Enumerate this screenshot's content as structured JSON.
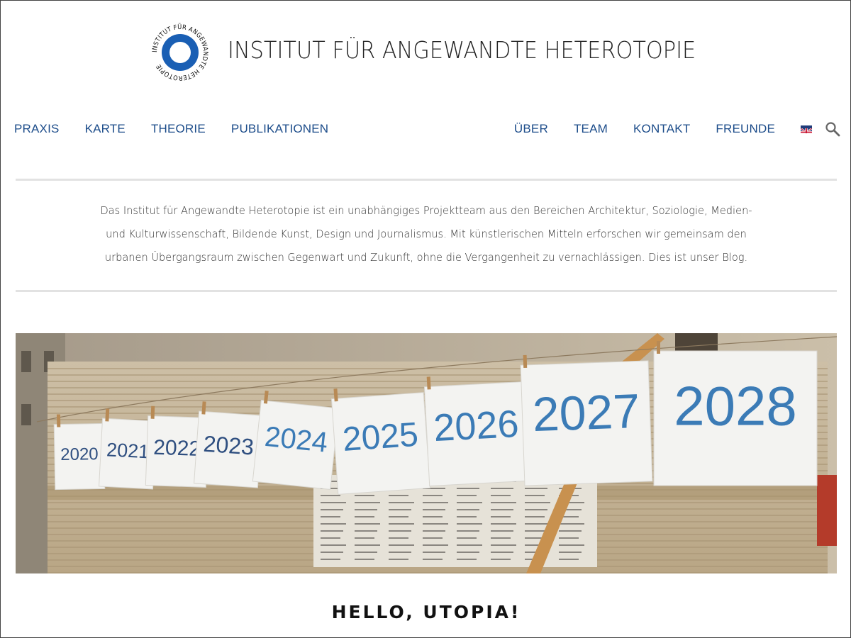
{
  "site": {
    "title": "INSTITUT FÜR ANGEWANDTE HETEROTOPIE",
    "logo_text": "INSTITUT FÜR ANGEWANDTE HETEROTOPIE",
    "logo_color": "#1a5fb4"
  },
  "nav": {
    "left": [
      "PRAXIS",
      "KARTE",
      "THEORIE",
      "PUBLIKATIONEN"
    ],
    "right": [
      "ÜBER",
      "TEAM",
      "KONTAKT",
      "FREUNDE"
    ],
    "language_flag": "uk-flag-icon",
    "search": "search-icon",
    "link_color": "#1c4c8a"
  },
  "intro": {
    "text": "Das Institut für Angewandte Heterotopie ist ein unabhängiges Projektteam aus den Bereichen Architektur, Soziologie, Medien- und Kulturwissenschaft, Bildende Kunst, Design und Journalismus. Mit künstlerischen Mitteln erforschen wir gemeinsam den urbanen Übergangsraum zwischen Gegenwart und Zukunft, ohne die Vergangenheit zu vernachlässigen. Dies ist unser Blog."
  },
  "hero": {
    "years": [
      "2020",
      "2021",
      "2022",
      "2023",
      "2024",
      "2025",
      "2026",
      "2027",
      "2028"
    ]
  },
  "post": {
    "title": "HELLO, UTOPIA!"
  }
}
